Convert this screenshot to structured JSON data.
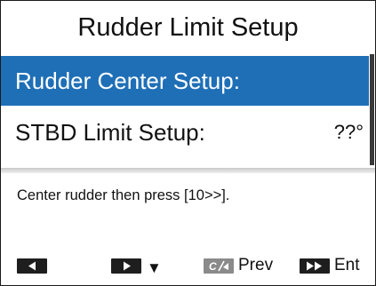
{
  "screen": {
    "title": "Rudder Limit Setup"
  },
  "menu": {
    "items": [
      {
        "label": "Rudder Center Setup:",
        "value": "",
        "selected": true
      },
      {
        "label": "STBD Limit Setup:",
        "value": "??°",
        "selected": false
      }
    ]
  },
  "message": "Center rudder then press [10>>].",
  "softkeys": {
    "key1": {
      "icon": "left-arrow-icon"
    },
    "key2": {
      "icon": "right-arrow-icon",
      "glyph": "▼"
    },
    "key3": {
      "icon": "power-icon",
      "label": "Prev"
    },
    "key4": {
      "icon": "fast-forward-icon",
      "label": "Ent"
    }
  },
  "colors": {
    "selection": "#1f6fb7",
    "text": "#111111",
    "background": "#ffffff"
  }
}
